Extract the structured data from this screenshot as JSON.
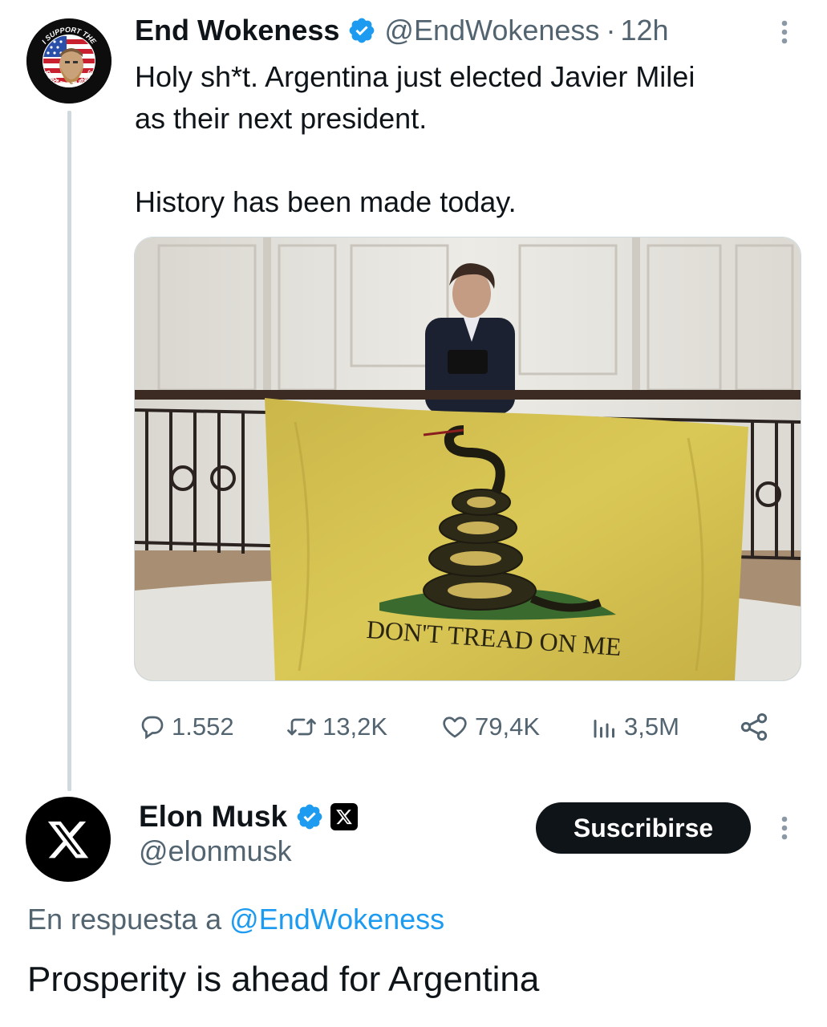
{
  "original_tweet": {
    "author_name": "End Wokeness",
    "author_handle": "@EndWokeness",
    "separator": "·",
    "time": "12h",
    "text": "Holy sh*t. Argentina just elected Javier Milei\nas their next president.\n\nHistory has been made today.",
    "avatar_text_top": "I SUPPORT THE",
    "avatar_text_bottom": "FORMER THINGS",
    "flag_text": "DON'T TREAD ON ME",
    "stats": {
      "replies": "1.552",
      "retweets": "13,2K",
      "likes": "79,4K",
      "views": "3,5M"
    }
  },
  "reply_tweet": {
    "author_name": "Elon Musk",
    "author_handle": "@elonmusk",
    "subscribe_label": "Suscribirse",
    "reply_prefix": "En respuesta a",
    "reply_to_handle": "@EndWokeness",
    "text": "Prosperity is ahead for Argentina"
  },
  "icons": {
    "verified": "verified-badge-icon",
    "more": "more-vertical-icon",
    "reply": "reply-icon",
    "retweet": "retweet-icon",
    "like": "heart-icon",
    "views": "views-icon",
    "share": "share-icon",
    "x_logo": "x-logo-icon"
  },
  "colors": {
    "text_primary": "#0f1419",
    "text_secondary": "#536471",
    "link": "#1d9bf0",
    "verified": "#1d9bf0",
    "button_bg": "#0f1419",
    "thread_line": "#cfd9de",
    "flag_yellow": "#d4c04a"
  }
}
